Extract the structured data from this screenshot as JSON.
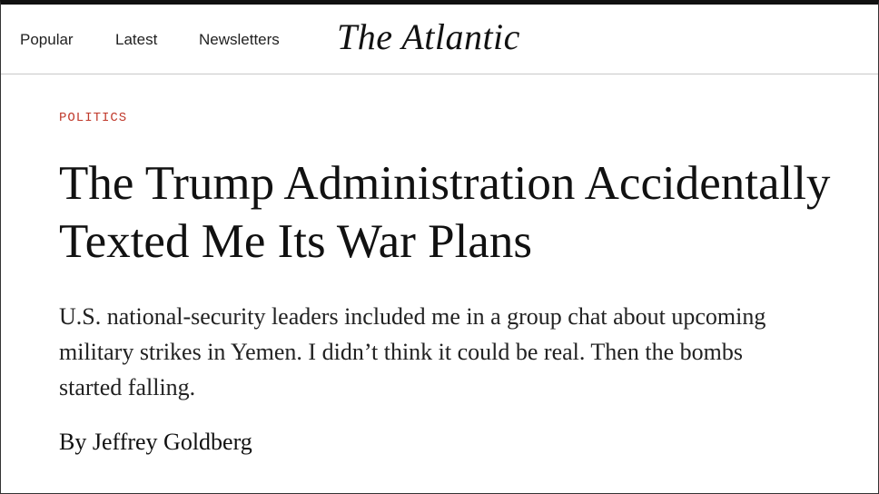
{
  "nav": {
    "items": [
      {
        "label": "Popular"
      },
      {
        "label": "Latest"
      },
      {
        "label": "Newsletters"
      }
    ],
    "logo": "The Atlantic"
  },
  "article": {
    "section": "POLITICS",
    "headline": "The Trump Administration Accidentally Texted Me Its War Plans",
    "dek": "U.S. national-security leaders included me in a group chat about upcoming military strikes in Yemen. I didn’t think it could be real. Then the bombs started falling.",
    "byline": "By Jeffrey Goldberg"
  },
  "colors": {
    "section_accent": "#c0392b",
    "text": "#111111",
    "background": "#ffffff"
  }
}
